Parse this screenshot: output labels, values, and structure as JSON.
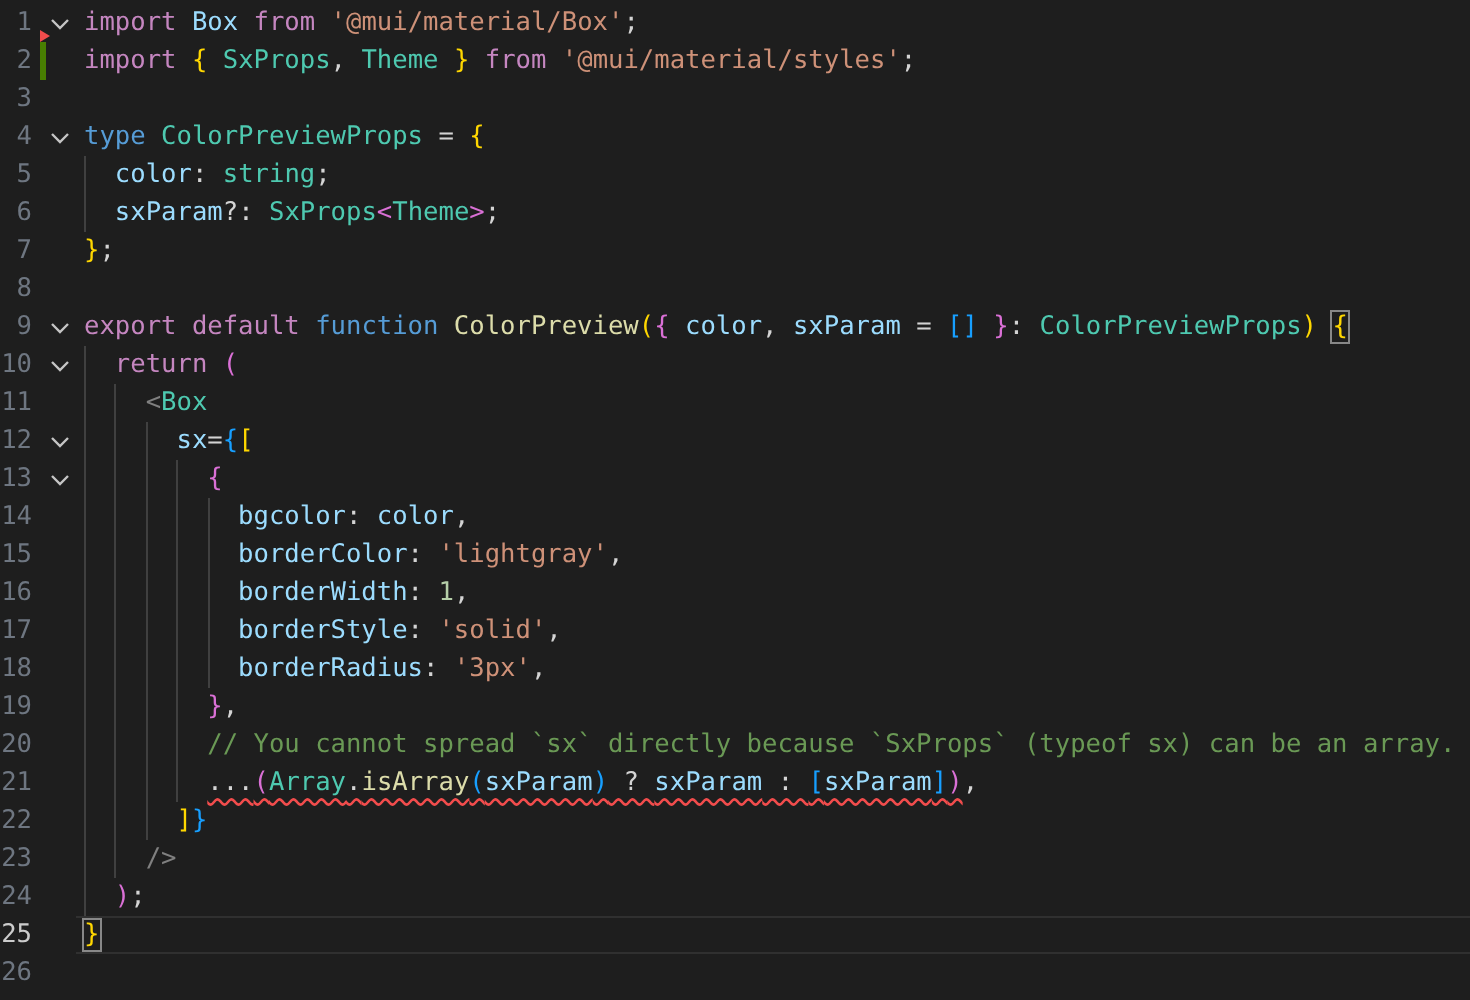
{
  "lines": [
    {
      "number": "1",
      "fold": true,
      "selected": false,
      "matched_bracket": false,
      "error": false,
      "added": false,
      "deleted": true,
      "tokens": [
        {
          "text": "import ",
          "kind": "kw"
        },
        {
          "text": "Box ",
          "kind": "var"
        },
        {
          "text": "from ",
          "kind": "kw"
        },
        {
          "text": "'@mui/material/Box'",
          "kind": "str"
        },
        {
          "text": ";",
          "kind": "pun"
        }
      ]
    },
    {
      "number": "2",
      "fold": false,
      "selected": false,
      "matched_bracket": false,
      "error": false,
      "added": true,
      "deleted": false,
      "tokens": [
        {
          "text": "import ",
          "kind": "kw"
        },
        {
          "text": "{ ",
          "kind": "b1"
        },
        {
          "text": "SxProps",
          "kind": "ty"
        },
        {
          "text": ", ",
          "kind": "pun"
        },
        {
          "text": "Theme ",
          "kind": "ty"
        },
        {
          "text": "} ",
          "kind": "b1"
        },
        {
          "text": "from ",
          "kind": "kw"
        },
        {
          "text": "'@mui/material/styles'",
          "kind": "str"
        },
        {
          "text": ";",
          "kind": "pun"
        }
      ]
    },
    {
      "number": "3",
      "fold": false,
      "selected": false,
      "added": false,
      "deleted": false
    },
    {
      "number": "4",
      "fold": true,
      "selected": false,
      "matched_bracket": false,
      "error": false,
      "added": false,
      "deleted": false,
      "tokens": [
        {
          "text": "type ",
          "kind": "st"
        },
        {
          "text": "ColorPreviewProps",
          "kind": "ty"
        },
        {
          "text": " = ",
          "kind": "pun"
        },
        {
          "text": "{",
          "kind": "b1"
        }
      ]
    },
    {
      "number": "5",
      "fold": false,
      "selected": false,
      "matched_bracket": false,
      "error": false,
      "added": false,
      "deleted": false,
      "tokens": [
        {
          "text": "  color",
          "kind": "var"
        },
        {
          "text": ": ",
          "kind": "pun"
        },
        {
          "text": "string",
          "kind": "ty"
        },
        {
          "text": ";",
          "kind": "pun"
        }
      ]
    },
    {
      "number": "6",
      "fold": false,
      "selected": false,
      "matched_bracket": false,
      "error": false,
      "added": false,
      "deleted": false,
      "tokens": [
        {
          "text": "  sxParam",
          "kind": "var"
        },
        {
          "text": "?: ",
          "kind": "pun"
        },
        {
          "text": "SxProps",
          "kind": "ty"
        },
        {
          "text": "<",
          "kind": "b2"
        },
        {
          "text": "Theme",
          "kind": "ty"
        },
        {
          "text": ">",
          "kind": "b2"
        },
        {
          "text": ";",
          "kind": "pun"
        }
      ]
    },
    {
      "number": "7",
      "fold": false,
      "selected": false,
      "matched_bracket": false,
      "error": false,
      "added": false,
      "deleted": false,
      "tokens": [
        {
          "text": "}",
          "kind": "b1"
        },
        {
          "text": ";",
          "kind": "pun"
        }
      ]
    },
    {
      "number": "8",
      "fold": false,
      "selected": false,
      "added": false,
      "deleted": false
    },
    {
      "number": "9",
      "fold": true,
      "selected": false,
      "matched_bracket": true,
      "error": false,
      "added": false,
      "deleted": false,
      "tokens": [
        {
          "text": "export ",
          "kind": "kw"
        },
        {
          "text": "default ",
          "kind": "kw"
        },
        {
          "text": "function ",
          "kind": "st"
        },
        {
          "text": "ColorPreview",
          "kind": "fn"
        },
        {
          "text": "(",
          "kind": "b1"
        },
        {
          "text": "{ ",
          "kind": "b2"
        },
        {
          "text": "color",
          "kind": "var"
        },
        {
          "text": ", ",
          "kind": "pun"
        },
        {
          "text": "sxParam",
          "kind": "var"
        },
        {
          "text": " = ",
          "kind": "pun"
        },
        {
          "text": "[] ",
          "kind": "b3"
        },
        {
          "text": "}",
          "kind": "b2"
        },
        {
          "text": ": ",
          "kind": "pun"
        },
        {
          "text": "ColorPreviewProps",
          "kind": "ty"
        },
        {
          "text": ") ",
          "kind": "b1"
        },
        {
          "text": "{",
          "kind": "b1"
        }
      ]
    },
    {
      "number": "10",
      "fold": true,
      "selected": false,
      "matched_bracket": false,
      "error": false,
      "added": false,
      "deleted": false,
      "tokens": [
        {
          "text": "  return ",
          "kind": "kw"
        },
        {
          "text": "(",
          "kind": "b2"
        }
      ]
    },
    {
      "number": "11",
      "fold": false,
      "selected": false,
      "matched_bracket": false,
      "error": false,
      "added": false,
      "deleted": false,
      "tokens": [
        {
          "text": "    <",
          "kind": "tag"
        },
        {
          "text": "Box",
          "kind": "ty"
        }
      ]
    },
    {
      "number": "12",
      "fold": true,
      "selected": false,
      "matched_bracket": false,
      "error": false,
      "added": false,
      "deleted": false,
      "tokens": [
        {
          "text": "      sx",
          "kind": "var"
        },
        {
          "text": "=",
          "kind": "pun"
        },
        {
          "text": "{",
          "kind": "b3"
        },
        {
          "text": "[",
          "kind": "b1"
        }
      ]
    },
    {
      "number": "13",
      "fold": true,
      "selected": false,
      "matched_bracket": false,
      "error": false,
      "added": false,
      "deleted": false,
      "tokens": [
        {
          "text": "        {",
          "kind": "b2"
        }
      ]
    },
    {
      "number": "14",
      "fold": false,
      "selected": false,
      "matched_bracket": false,
      "error": false,
      "added": false,
      "deleted": false,
      "tokens": [
        {
          "text": "          bgcolor",
          "kind": "var"
        },
        {
          "text": ": ",
          "kind": "pun"
        },
        {
          "text": "color",
          "kind": "var"
        },
        {
          "text": ",",
          "kind": "pun"
        }
      ]
    },
    {
      "number": "15",
      "fold": false,
      "selected": false,
      "matched_bracket": false,
      "error": false,
      "added": false,
      "deleted": false,
      "tokens": [
        {
          "text": "          borderColor",
          "kind": "var"
        },
        {
          "text": ": ",
          "kind": "pun"
        },
        {
          "text": "'lightgray'",
          "kind": "str"
        },
        {
          "text": ",",
          "kind": "pun"
        }
      ]
    },
    {
      "number": "16",
      "fold": false,
      "selected": false,
      "matched_bracket": false,
      "error": false,
      "added": false,
      "deleted": false,
      "tokens": [
        {
          "text": "          borderWidth",
          "kind": "var"
        },
        {
          "text": ": ",
          "kind": "pun"
        },
        {
          "text": "1",
          "kind": "num"
        },
        {
          "text": ",",
          "kind": "pun"
        }
      ]
    },
    {
      "number": "17",
      "fold": false,
      "selected": false,
      "matched_bracket": false,
      "error": false,
      "added": false,
      "deleted": false,
      "tokens": [
        {
          "text": "          borderStyle",
          "kind": "var"
        },
        {
          "text": ": ",
          "kind": "pun"
        },
        {
          "text": "'solid'",
          "kind": "str"
        },
        {
          "text": ",",
          "kind": "pun"
        }
      ]
    },
    {
      "number": "18",
      "fold": false,
      "selected": false,
      "matched_bracket": false,
      "error": false,
      "added": false,
      "deleted": false,
      "tokens": [
        {
          "text": "          borderRadius",
          "kind": "var"
        },
        {
          "text": ": ",
          "kind": "pun"
        },
        {
          "text": "'3px'",
          "kind": "str"
        },
        {
          "text": ",",
          "kind": "pun"
        }
      ]
    },
    {
      "number": "19",
      "fold": false,
      "selected": false,
      "matched_bracket": false,
      "error": false,
      "added": false,
      "deleted": false,
      "tokens": [
        {
          "text": "        }",
          "kind": "b2"
        },
        {
          "text": ",",
          "kind": "pun"
        }
      ]
    },
    {
      "number": "20",
      "fold": false,
      "selected": false,
      "matched_bracket": false,
      "error": false,
      "added": false,
      "deleted": false,
      "tokens": [
        {
          "text": "        // You cannot spread `sx` directly because `SxProps` (typeof sx) can be an array.",
          "kind": "com"
        }
      ]
    },
    {
      "number": "21",
      "fold": false,
      "selected": false,
      "matched_bracket": false,
      "error": true,
      "added": false,
      "deleted": false,
      "tokens": [
        {
          "text": "        ...",
          "kind": "pun"
        },
        {
          "text": "(",
          "kind": "b2"
        },
        {
          "text": "Array",
          "kind": "ty"
        },
        {
          "text": ".",
          "kind": "pun"
        },
        {
          "text": "isArray",
          "kind": "fn"
        },
        {
          "text": "(",
          "kind": "b3"
        },
        {
          "text": "sxParam",
          "kind": "var"
        },
        {
          "text": ")",
          "kind": "b3"
        },
        {
          "text": " ? ",
          "kind": "pun"
        },
        {
          "text": "sxParam",
          "kind": "var"
        },
        {
          "text": " : ",
          "kind": "pun"
        },
        {
          "text": "[",
          "kind": "b3"
        },
        {
          "text": "sxParam",
          "kind": "var"
        },
        {
          "text": "]",
          "kind": "b3"
        },
        {
          "text": ")",
          "kind": "b2"
        },
        {
          "text": ",",
          "kind": "pun"
        }
      ]
    },
    {
      "number": "22",
      "fold": false,
      "selected": false,
      "matched_bracket": false,
      "error": false,
      "added": false,
      "deleted": false,
      "tokens": [
        {
          "text": "      ]",
          "kind": "b1"
        },
        {
          "text": "}",
          "kind": "b3"
        }
      ]
    },
    {
      "number": "23",
      "fold": false,
      "selected": false,
      "matched_bracket": false,
      "error": false,
      "added": false,
      "deleted": false,
      "tokens": [
        {
          "text": "    />",
          "kind": "tag"
        }
      ]
    },
    {
      "number": "24",
      "fold": false,
      "selected": false,
      "matched_bracket": false,
      "error": false,
      "added": false,
      "deleted": false,
      "tokens": [
        {
          "text": "  )",
          "kind": "b2"
        },
        {
          "text": ";",
          "kind": "pun"
        }
      ]
    },
    {
      "number": "25",
      "fold": false,
      "selected": true,
      "matched_bracket": true,
      "error": false,
      "added": false,
      "deleted": false,
      "tokens": [
        {
          "text": "}",
          "kind": "b1"
        }
      ]
    },
    {
      "number": "26",
      "fold": false,
      "selected": false,
      "added": false,
      "deleted": false
    }
  ]
}
